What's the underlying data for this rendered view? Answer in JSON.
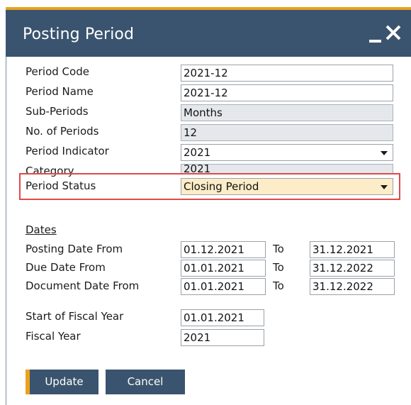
{
  "window": {
    "title": "Posting Period"
  },
  "form": {
    "period_code": {
      "label": "Period Code",
      "value": "2021-12"
    },
    "period_name": {
      "label": "Period Name",
      "value": "2021-12"
    },
    "sub_periods": {
      "label": "Sub-Periods",
      "value": "Months"
    },
    "no_of_periods": {
      "label": "No. of Periods",
      "value": "12"
    },
    "period_indicator": {
      "label": "Period Indicator",
      "value": "2021"
    },
    "category": {
      "label": "Category",
      "value": "2021"
    },
    "period_status": {
      "label": "Period Status",
      "value": "Closing Period"
    }
  },
  "dates": {
    "heading": "Dates",
    "to_label": "To",
    "posting": {
      "label": "Posting Date From",
      "from": "01.12.2021",
      "to": "31.12.2021"
    },
    "due": {
      "label": "Due Date From",
      "from": "01.01.2021",
      "to": "31.12.2022"
    },
    "document": {
      "label": "Document Date From",
      "from": "01.01.2021",
      "to": "31.12.2022"
    }
  },
  "fiscal": {
    "start": {
      "label": "Start of Fiscal Year",
      "value": "01.01.2021"
    },
    "year": {
      "label": "Fiscal Year",
      "value": "2021"
    }
  },
  "buttons": {
    "update": "Update",
    "cancel": "Cancel"
  },
  "colors": {
    "titlebar": "#3a546f",
    "accent": "#e9a21f",
    "highlight": "#e04a4a",
    "status_field": "#fcedc8",
    "readonly_field": "#e4e8ec"
  },
  "icons": {
    "minimize": "minimize-icon",
    "close": "close-icon",
    "dropdown": "chevron-down-icon"
  }
}
